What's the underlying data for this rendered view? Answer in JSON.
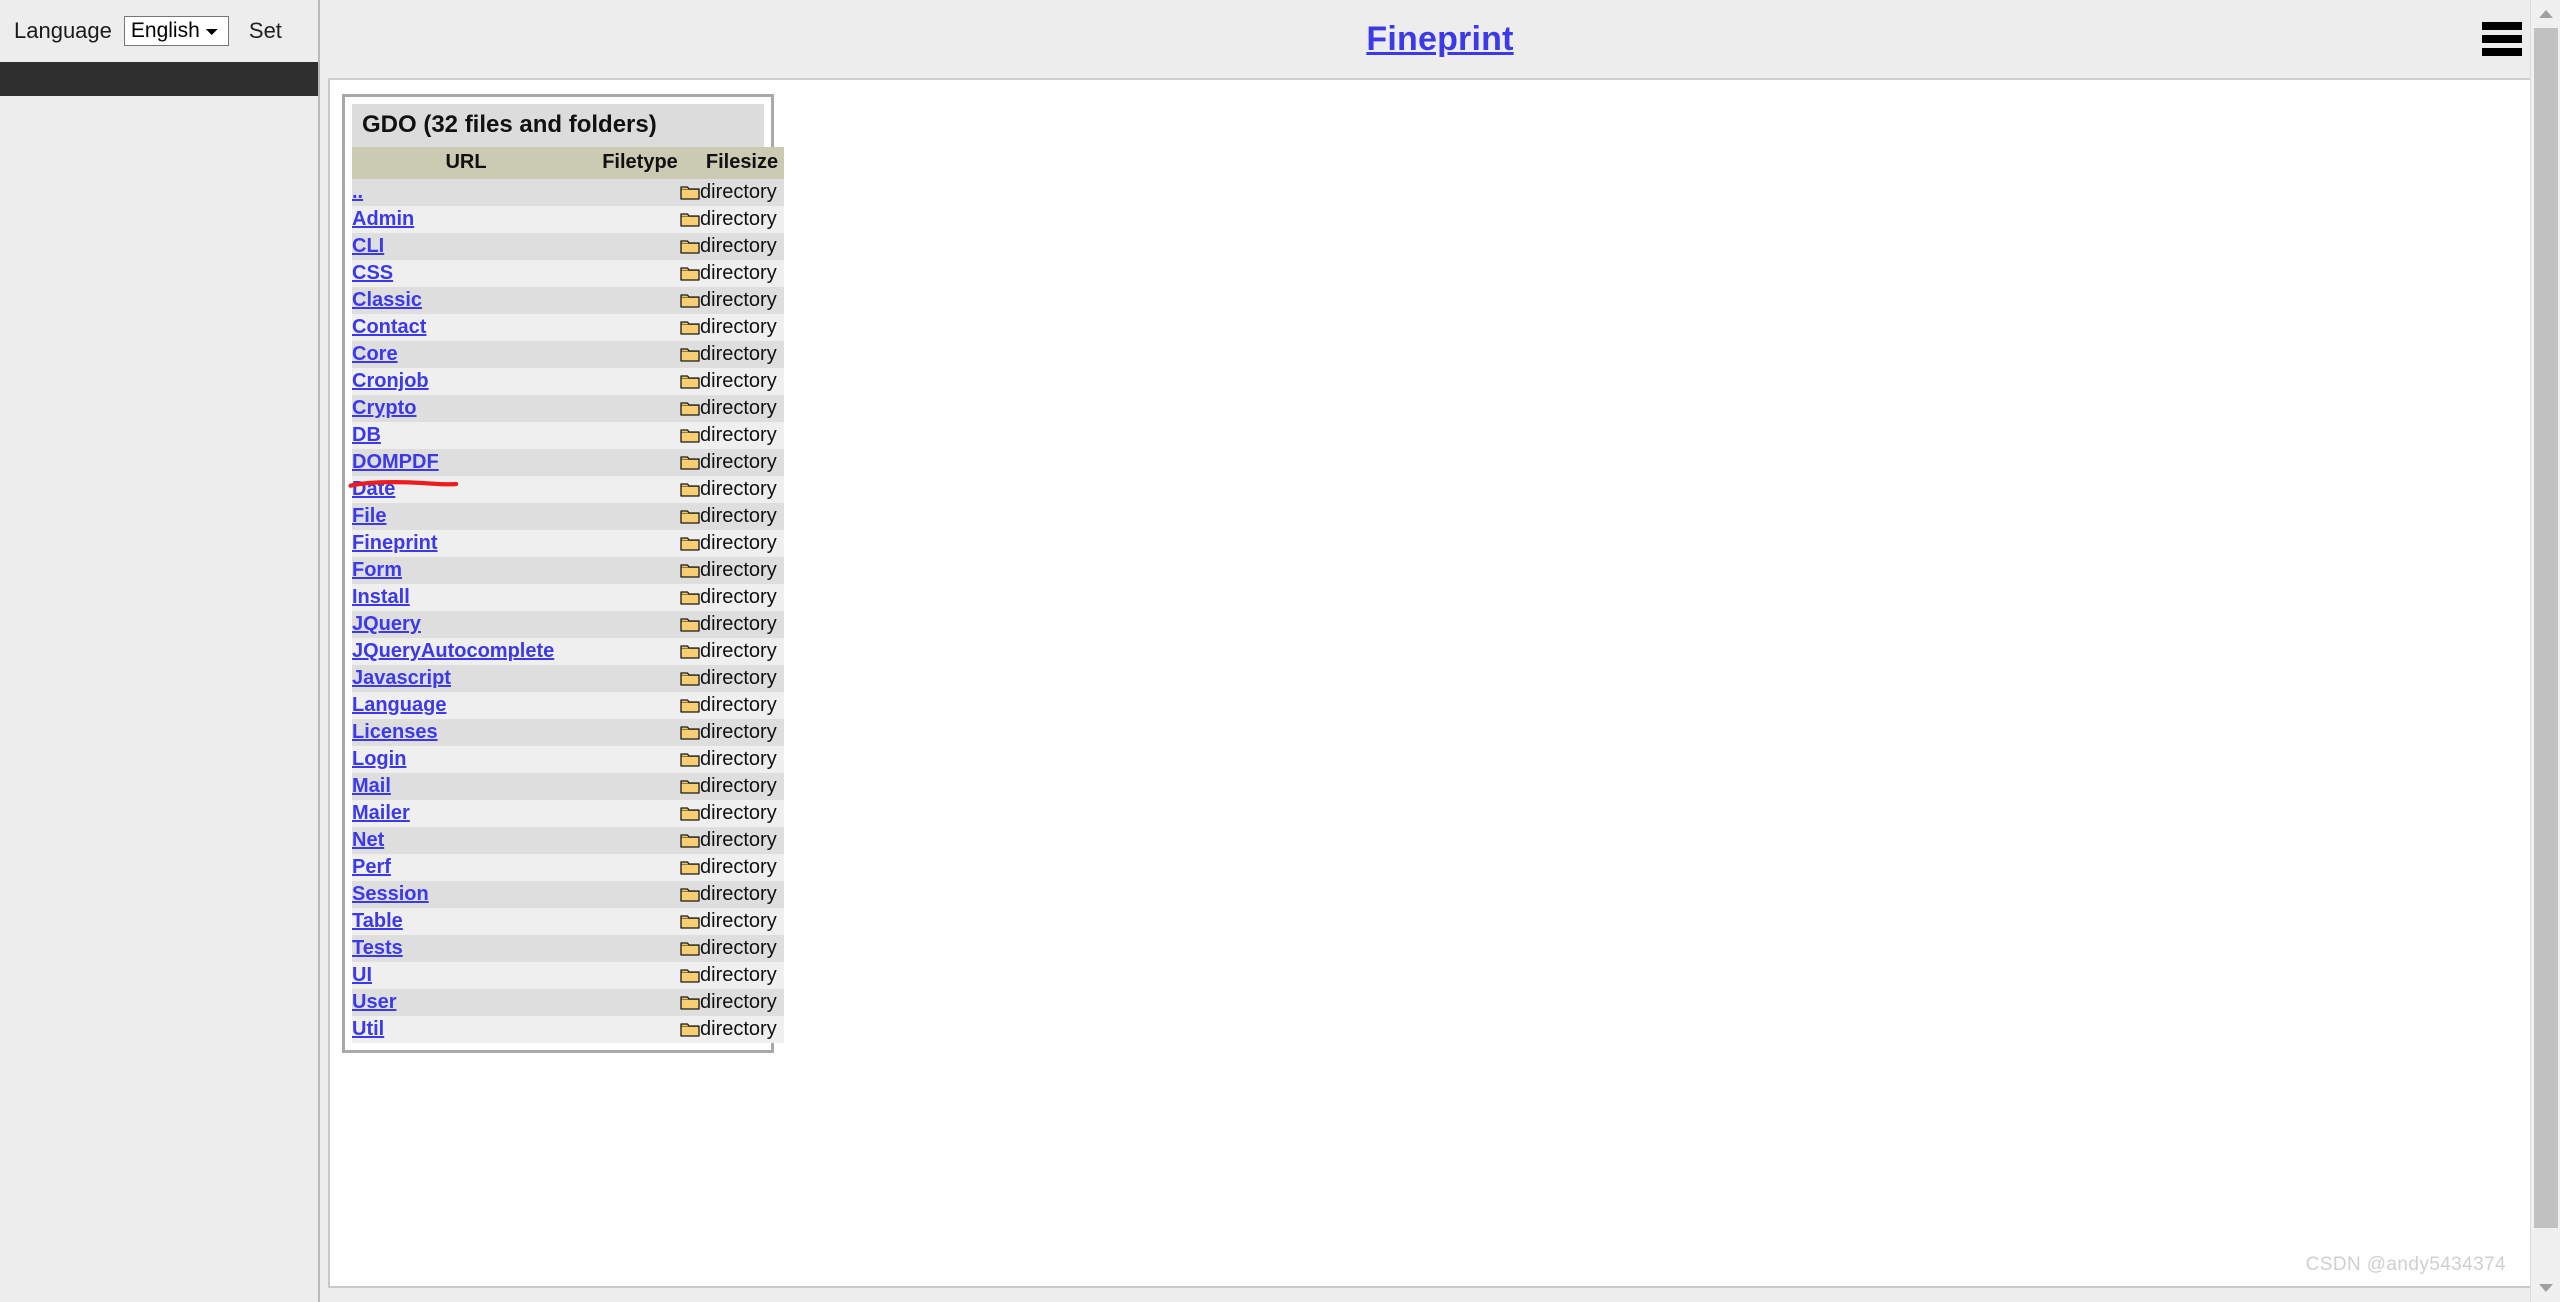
{
  "sidebar": {
    "language_label": "Language",
    "language_value": "English",
    "language_options": [
      "English"
    ],
    "set_label": "Set"
  },
  "topbar": {
    "title": "Fineprint",
    "menu_icon": "hamburger-menu-icon"
  },
  "panel": {
    "title": "GDO (32 files and folders)",
    "columns": {
      "url": "URL",
      "filetype": "Filetype",
      "filesize": "Filesize"
    },
    "rows": [
      {
        "name": "..",
        "type": "directory",
        "size": ""
      },
      {
        "name": "Admin",
        "type": "directory",
        "size": ""
      },
      {
        "name": "CLI",
        "type": "directory",
        "size": ""
      },
      {
        "name": "CSS",
        "type": "directory",
        "size": ""
      },
      {
        "name": "Classic",
        "type": "directory",
        "size": ""
      },
      {
        "name": "Contact",
        "type": "directory",
        "size": ""
      },
      {
        "name": "Core",
        "type": "directory",
        "size": ""
      },
      {
        "name": "Cronjob",
        "type": "directory",
        "size": ""
      },
      {
        "name": "Crypto",
        "type": "directory",
        "size": ""
      },
      {
        "name": "DB",
        "type": "directory",
        "size": ""
      },
      {
        "name": "DOMPDF",
        "type": "directory",
        "size": ""
      },
      {
        "name": "Date",
        "type": "directory",
        "size": ""
      },
      {
        "name": "File",
        "type": "directory",
        "size": ""
      },
      {
        "name": "Fineprint",
        "type": "directory",
        "size": ""
      },
      {
        "name": "Form",
        "type": "directory",
        "size": ""
      },
      {
        "name": "Install",
        "type": "directory",
        "size": ""
      },
      {
        "name": "JQuery",
        "type": "directory",
        "size": ""
      },
      {
        "name": "JQueryAutocomplete",
        "type": "directory",
        "size": ""
      },
      {
        "name": "Javascript",
        "type": "directory",
        "size": ""
      },
      {
        "name": "Language",
        "type": "directory",
        "size": ""
      },
      {
        "name": "Licenses",
        "type": "directory",
        "size": ""
      },
      {
        "name": "Login",
        "type": "directory",
        "size": ""
      },
      {
        "name": "Mail",
        "type": "directory",
        "size": ""
      },
      {
        "name": "Mailer",
        "type": "directory",
        "size": ""
      },
      {
        "name": "Net",
        "type": "directory",
        "size": ""
      },
      {
        "name": "Perf",
        "type": "directory",
        "size": ""
      },
      {
        "name": "Session",
        "type": "directory",
        "size": ""
      },
      {
        "name": "Table",
        "type": "directory",
        "size": ""
      },
      {
        "name": "Tests",
        "type": "directory",
        "size": ""
      },
      {
        "name": "UI",
        "type": "directory",
        "size": ""
      },
      {
        "name": "User",
        "type": "directory",
        "size": ""
      },
      {
        "name": "Util",
        "type": "directory",
        "size": ""
      }
    ]
  },
  "annotation": {
    "target_row": "DOMPDF",
    "color": "#ee1c1c",
    "kind": "hand-drawn-underline"
  },
  "watermark": {
    "text": "CSDN @andy5434374"
  },
  "colors": {
    "link": "#3b39e8",
    "panel_title_bg": "#dcdcdc",
    "table_header_bg": "#cbcbb4",
    "row_odd": "#dedede",
    "row_even": "#efefef",
    "sidebar_bg": "#ededed",
    "dark_band": "#2f2f2f",
    "annotation_red": "#ee1c1c"
  }
}
